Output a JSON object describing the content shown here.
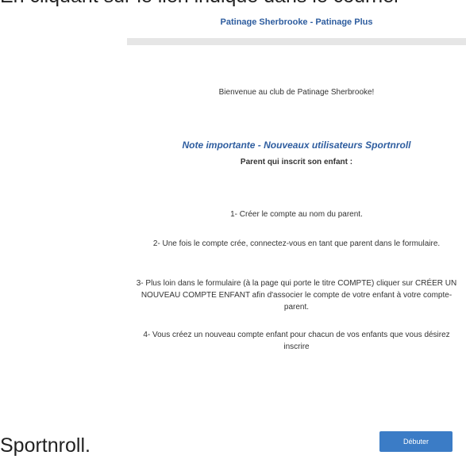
{
  "document": {
    "top_text": "En cliquant sur le lien indiqué dans le courriel",
    "bottom_text": "Sportnroll."
  },
  "form": {
    "header_title": "Patinage Sherbrooke - Patinage Plus",
    "welcome": "Bienvenue au club de Patinage Sherbrooke!",
    "note_title": "Note importante - Nouveaux utilisateurs Sportnroll",
    "note_subtitle": "Parent qui inscrit son enfant :",
    "steps": [
      "1- Créer le compte au nom du parent.",
      "2- Une fois le compte crée, connectez-vous en tant que parent dans le formulaire.",
      "3- Plus loin dans le formulaire (à la page qui porte le titre COMPTE) cliquer sur CRÉER UN NOUVEAU COMPTE ENFANT afin d'associer le compte de votre enfant à votre compte-parent.",
      "4- Vous créez un nouveau compte enfant pour chacun de vos enfants que vous désirez inscrire"
    ],
    "start_button_label": "Débuter"
  },
  "colors": {
    "accent": "#2e5d9f",
    "button": "#3b7cc6",
    "divider": "#e6e6e6"
  }
}
